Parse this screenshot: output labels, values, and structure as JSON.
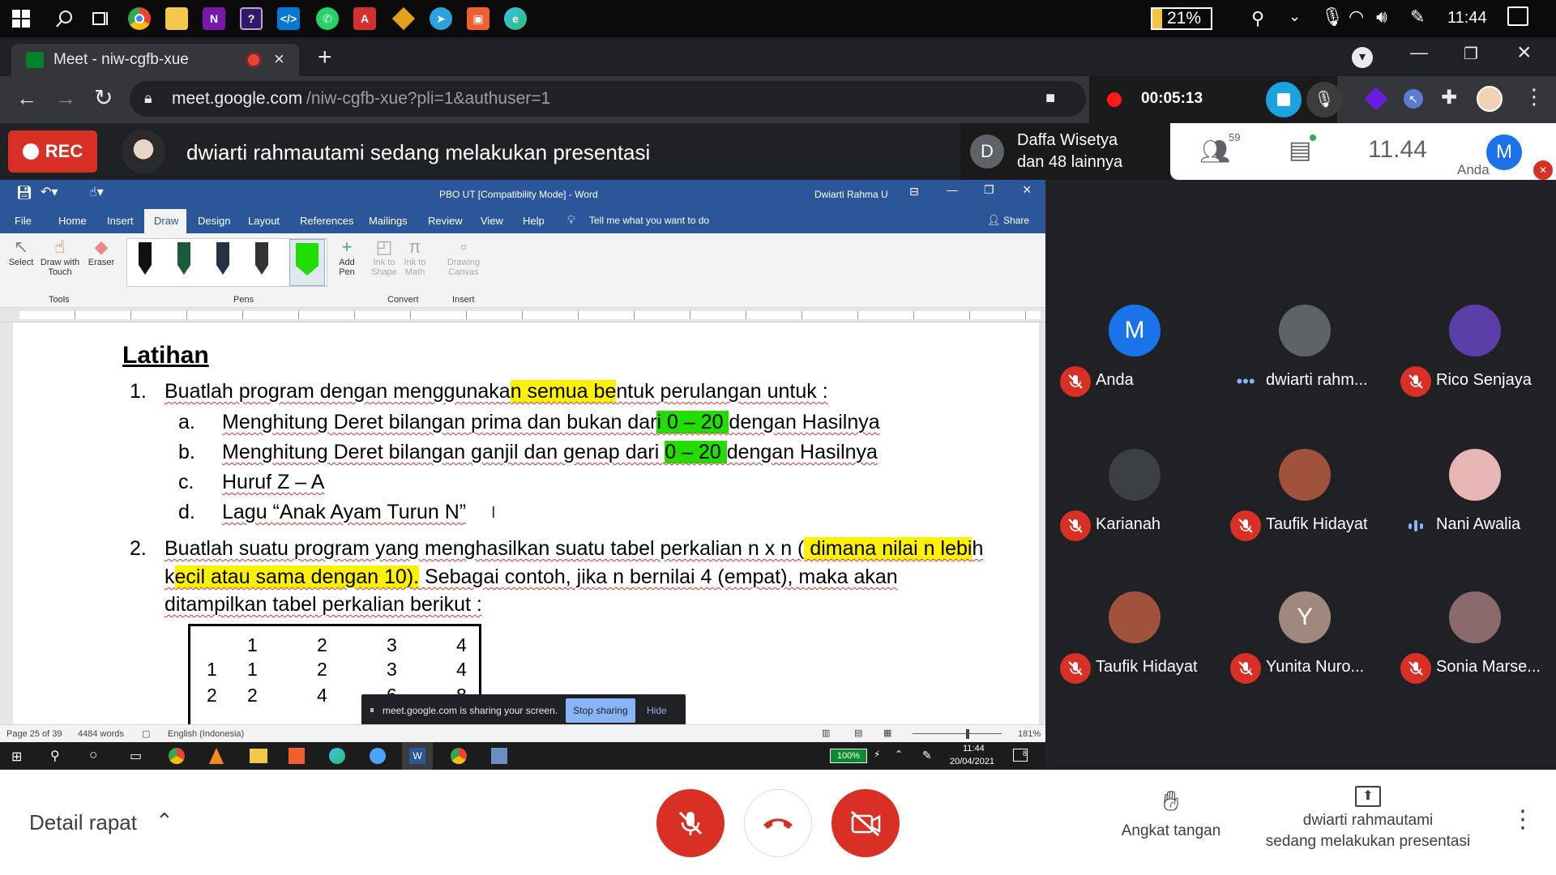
{
  "taskbar": {
    "battery": "21%",
    "time": "11:44"
  },
  "browser": {
    "tab_title": "Meet - niw-cgfb-xue",
    "url_host": "meet.google.com",
    "url_path": "/niw-cgfb-xue?pli=1&authuser=1",
    "recorder_time": "00:05:13"
  },
  "meet_header": {
    "rec_label": "REC",
    "presenting_text": "dwiarti rahmautami sedang melakukan presentasi",
    "participants_initial": "D",
    "participants_line1": "Daffa Wisetya",
    "participants_line2": "dan 48 lainnya",
    "people_count": "59",
    "clock": "11.44",
    "self_label": "Anda",
    "self_initial": "M"
  },
  "word": {
    "title": "PBO UT [Compatibility Mode]  -  Word",
    "user": "Dwiarti Rahma U",
    "ribbon_tabs": [
      "File",
      "Home",
      "Insert",
      "Draw",
      "Design",
      "Layout",
      "References",
      "Mailings",
      "Review",
      "View",
      "Help"
    ],
    "tell_me": "Tell me what you want to do",
    "share": "Share",
    "tools": {
      "select": "Select",
      "draw_touch_1": "Draw with",
      "draw_touch_2": "Touch",
      "eraser": "Eraser",
      "group_tools": "Tools",
      "group_pens": "Pens",
      "add_pen_1": "Add",
      "add_pen_2": "Pen",
      "ink_shape_1": "Ink to",
      "ink_shape_2": "Shape",
      "ink_math_1": "Ink to",
      "ink_math_2": "Math",
      "drawing_canvas_1": "Drawing",
      "drawing_canvas_2": "Canvas",
      "group_convert": "Convert",
      "group_insert": "Insert"
    },
    "doc": {
      "heading": "Latihan",
      "item1_num": "1.",
      "item1_a": "Buatlah program dengan menggunaka",
      "item1_b": "n semua be",
      "item1_c": "ntuk perulangan untuk :",
      "a_lbl": "a.",
      "a_t1": "Menghitung Deret bilangan prima dan bukan dar",
      "a_t2": "i 0 – 20 ",
      "a_t3": "dengan Hasilnya",
      "b_lbl": "b.",
      "b_t1": "Menghitung Deret bilangan ganjil dan genap dari ",
      "b_t2": "0 – 20 ",
      "b_t3": "dengan Hasilnya",
      "c_lbl": "c.",
      "c_text": "Huruf Z – A",
      "d_lbl": "d.",
      "d_text": "Lagu “Anak Ayam Turun N”",
      "item2_num": "2.",
      "i2_l1a": "Buatlah suatu program yang menghasilkan suatu tabel perkalian n x n (",
      "i2_l1b": " dimana nilai n lebi",
      "i2_l1c": "h",
      "i2_l2a": "k",
      "i2_l2b": "ecil atau sama dengan 10).",
      "i2_l2c": " Sebagai contoh, jika n bernilai 4 (empat), maka akan",
      "i2_l3": "ditampilkan tabel perkalian berikut :",
      "table_header": [
        "",
        "1",
        "2",
        "3",
        "4"
      ],
      "table_row1": [
        "1",
        "1",
        "2",
        "3",
        "4"
      ],
      "table_row2": [
        "2",
        "2",
        "4",
        "6",
        "8"
      ]
    },
    "status": {
      "page": "Page 25 of 39",
      "words": "4484 words",
      "lang": "English (Indonesia)",
      "zoom": "181%"
    },
    "share_bar": {
      "text": "meet.google.com is sharing your screen.",
      "stop": "Stop sharing",
      "hide": "Hide"
    },
    "inner_taskbar": {
      "battery": "100%",
      "time": "11:44",
      "date": "20/04/2021",
      "notif": "8"
    }
  },
  "participants": [
    {
      "name": "Anda",
      "initial": "M",
      "color": "#1a73e8",
      "status": "muted"
    },
    {
      "name": "dwiarti rahm...",
      "initial": "",
      "color": "#5f6368",
      "status": "more"
    },
    {
      "name": "Rico Senjaya",
      "initial": "",
      "color": "#5a3fa8",
      "status": "muted"
    },
    {
      "name": "Karianah",
      "initial": "",
      "color": "#3c4043",
      "status": "muted"
    },
    {
      "name": "Taufik Hidayat",
      "initial": "",
      "color": "#a0523c",
      "status": "muted"
    },
    {
      "name": "Nani Awalia",
      "initial": "",
      "color": "#e9b6b6",
      "status": "speaking"
    },
    {
      "name": "Taufik Hidayat",
      "initial": "",
      "color": "#a0523c",
      "status": "muted"
    },
    {
      "name": "Yunita Nuro...",
      "initial": "Y",
      "color": "#a1887f",
      "status": "muted"
    },
    {
      "name": "Sonia Marse...",
      "initial": "",
      "color": "#8a6a6a",
      "status": "muted"
    }
  ],
  "bottom": {
    "details": "Detail rapat",
    "raise_hand": "Angkat tangan",
    "presenting_1": "dwiarti rahmautami",
    "presenting_2": "sedang melakukan presentasi"
  }
}
